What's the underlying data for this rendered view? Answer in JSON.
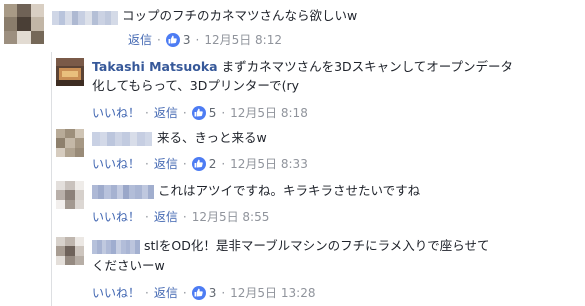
{
  "comments": [
    {
      "text": "コップのフチのカネマツさんなら欲しいw",
      "actions": {
        "like_label": "",
        "reply_label": "返信",
        "likes": "3",
        "time": "12月5日 8:12"
      },
      "avatar_colors": [
        "#a89a86",
        "#6f6256",
        "#d9cfc3",
        "#8a7d6c",
        "#4a3f36",
        "#c2b6a6",
        "#9c8f7f",
        "#e2dbd2",
        "#756858"
      ],
      "name_colors": [
        "#cfd6e6",
        "#b9c4dc",
        "#d8dde9",
        "#aeb9d2",
        "#c7cfe2",
        "#dde1ea",
        "#b4bfd6",
        "#cbd2e3",
        "#c0c9dd",
        "#d4dae7"
      ]
    },
    {
      "name": "Takashi Matsuoka",
      "text_line1": "まずカネマツさんを3Dスキャンしてオープンデータ",
      "text_line2": "化してもらって、3Dプリンターで(ry",
      "actions": {
        "like_label": "いいね！",
        "reply_label": "返信",
        "likes": "5",
        "time": "12月5日 8:18"
      }
    },
    {
      "text": "来る、きっと来るw",
      "actions": {
        "like_label": "いいね！",
        "reply_label": "返信",
        "likes": "2",
        "time": "12月5日 8:33"
      },
      "avatar_colors": [
        "#b8ab98",
        "#9d8f7b",
        "#cfc4b4",
        "#8e806d",
        "#c4b8a7",
        "#a69884",
        "#d6ccbf",
        "#b0a390",
        "#998b78"
      ],
      "name_colors": [
        "#c9d1e4",
        "#d3d9e8",
        "#bcc6dd",
        "#cdd4e5",
        "#c2cbe0",
        "#d8dde9",
        "#c6cee2",
        "#d0d7e7"
      ]
    },
    {
      "text": "これはアツイですね。キラキラさせたいですね",
      "actions": {
        "like_label": "いいね！",
        "reply_label": "返信",
        "time": "12月5日 8:55"
      },
      "avatar_colors": [
        "#e3dfdc",
        "#c9c2bd",
        "#efece9",
        "#b9b0aa",
        "#8c817a",
        "#d6d0cb",
        "#f2efed",
        "#a39991",
        "#dcd7d3"
      ],
      "name_colors": [
        "#aeb9d6",
        "#9eabcc",
        "#b8c2dc",
        "#a6b2d1",
        "#c3cbe1",
        "#9aa7c9",
        "#b2bdd8",
        "#a9b5d3",
        "#bfc8df",
        "#a1aece"
      ]
    },
    {
      "text_line1": "stlをOD化！是非マーブルマシンのフチにラメ入りで座らせて",
      "text_line2": "くださいーw",
      "actions": {
        "like_label": "いいね！",
        "reply_label": "返信",
        "likes": "3",
        "time": "12月5日 13:28"
      },
      "avatar_colors": [
        "#d8d2cc",
        "#bfb6ae",
        "#ece8e4",
        "#a89d93",
        "#6e625a",
        "#cdc5be",
        "#e4dfda",
        "#958a81",
        "#b7aea6"
      ],
      "name_colors": [
        "#b6c1db",
        "#a7b3d2",
        "#c0c9df",
        "#afbad7",
        "#9fadcf",
        "#c6cee2",
        "#b2bdd9",
        "#a9b5d4",
        "#bcc5dd",
        "#a3b0d0"
      ]
    }
  ],
  "colors": {
    "link": "#4267b2",
    "name": "#365899",
    "meta": "#90949c",
    "like_badge": "#4d7cf3"
  },
  "icons": {
    "like": "thumbs-up-icon"
  }
}
